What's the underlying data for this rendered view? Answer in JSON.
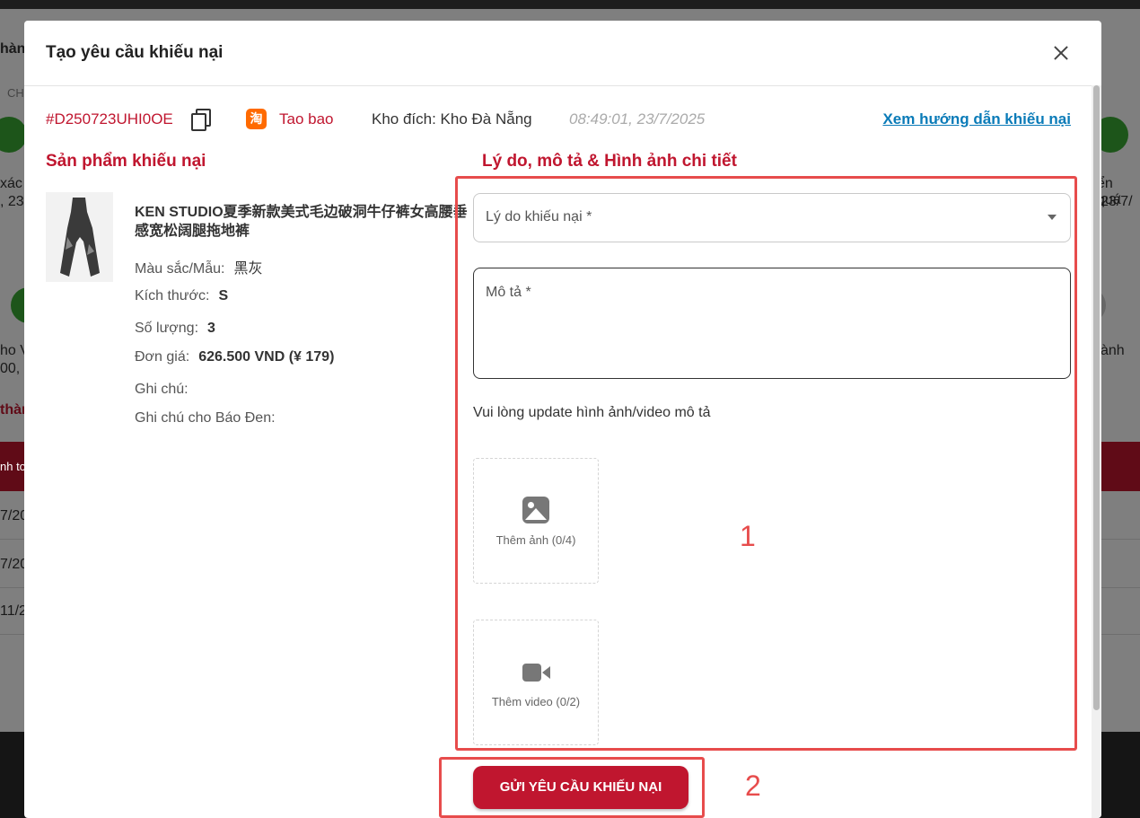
{
  "background": {
    "left_texts": [
      "hàn",
      "CH",
      "xác",
      ", 23",
      "ho V",
      "00,",
      "thàn",
      "nh to",
      "7/20",
      "7/20",
      "11/2"
    ],
    "right_texts": [
      "ển quá",
      "23/7/",
      "ành"
    ]
  },
  "modal": {
    "title": "Tạo yêu cầu khiếu nại",
    "close_label": "×"
  },
  "order": {
    "code": "#D250723UHI0OE",
    "platform_icon": "淘",
    "platform": "Tao bao",
    "warehouse": "Kho đích: Kho Đà Nẵng",
    "time": "08:49:01, 23/7/2025",
    "guide_link": "Xem hướng dẫn khiếu nại"
  },
  "product_section": {
    "title": "Sản phẩm khiếu nại",
    "name": "KEN STUDIO夏季新款美式毛边破洞牛仔裤女高腰垂感宽松阔腿拖地裤",
    "color_label": "Màu sắc/Mẫu:",
    "color_value": "黑灰",
    "size_label": "Kích thước:",
    "size_value": "S",
    "qty_label": "Số lượng:",
    "qty_value": "3",
    "price_label": "Đơn giá:",
    "price_value": "626.500 VND (¥ 179)",
    "note_label": "Ghi chú:",
    "note_bd_label": "Ghi chú cho Báo Đen:"
  },
  "reason_section": {
    "title": "Lý do, mô tả & Hình ảnh chi tiết",
    "reason_placeholder": "Lý do khiếu nại *",
    "desc_placeholder": "Mô tả *",
    "upload_hint": "Vui lòng update hình ảnh/video mô tả",
    "add_image": "Thêm ảnh (0/4)",
    "add_video": "Thêm video (0/2)"
  },
  "annotations": {
    "one": "1",
    "two": "2"
  },
  "submit_label": "GỬI YÊU CẦU KHIẾU NẠI",
  "colors": {
    "brand_red": "#c0162f",
    "link_blue": "#0a7bb8",
    "annotation_red": "#e74c4c"
  }
}
